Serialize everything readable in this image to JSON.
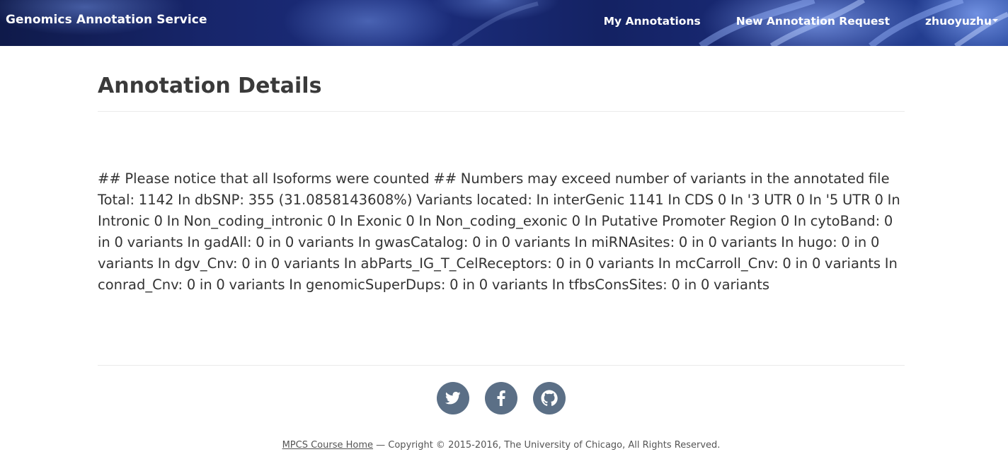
{
  "header": {
    "brand": "Genomics Annotation Service",
    "nav": {
      "my_annotations": "My Annotations",
      "new_request": "New Annotation Request",
      "user": "zhuoyuzhu"
    }
  },
  "main": {
    "title": "Annotation Details",
    "details": "## Please notice that all Isoforms were counted ## Numbers may exceed number of variants in the annotated file Total: 1142 In dbSNP: 355 (31.0858143608%) Variants located: In interGenic 1141 In CDS 0 In '3 UTR 0 In '5 UTR 0 In Intronic 0 In Non_coding_intronic 0 In Exonic 0 In Non_coding_exonic 0 In Putative Promoter Region 0 In cytoBand: 0 in 0 variants In gadAll: 0 in 0 variants In gwasCatalog: 0 in 0 variants In miRNAsites: 0 in 0 variants In hugo: 0 in 0 variants In dgv_Cnv: 0 in 0 variants In abParts_IG_T_CelReceptors: 0 in 0 variants In mcCarroll_Cnv: 0 in 0 variants In conrad_Cnv: 0 in 0 variants In genomicSuperDups: 0 in 0 variants In tfbsConsSites: 0 in 0 variants"
  },
  "footer": {
    "social": [
      {
        "icon": "twitter-icon"
      },
      {
        "icon": "facebook-icon"
      },
      {
        "icon": "github-icon"
      }
    ],
    "course_link": "MPCS Course Home",
    "copyright": " — Copyright © 2015-2016, The University of Chicago, All Rights Reserved."
  },
  "colors": {
    "navbar": "#17256a",
    "social_button": "#5b6f86",
    "title_text": "#3a3a3a"
  }
}
